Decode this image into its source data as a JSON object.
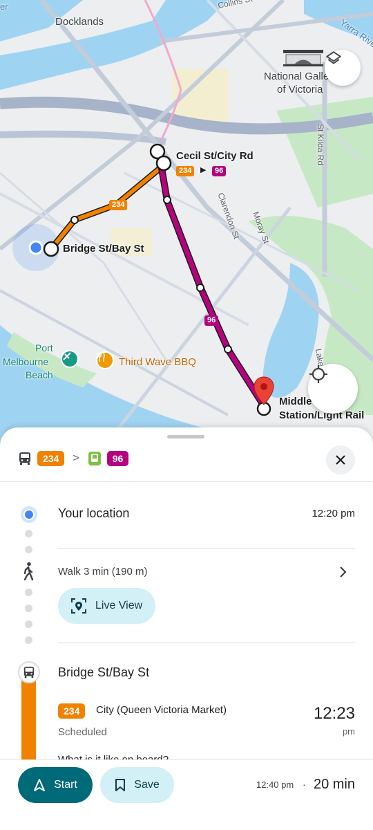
{
  "map": {
    "labels": {
      "docklands": "Docklands",
      "collins": "Collins St",
      "yarra": "Yarra River",
      "ngv_line1": "National Galle",
      "ngv_line2": "of Victoria",
      "stkilda": "St Kilda Rd",
      "clarendon": "Clarendon St",
      "moray": "Moray St",
      "lake": "Lake",
      "port_line1": "Port",
      "port_line2": "Melbourne",
      "port_line3": "Beach",
      "bbq": "Third Wave BBQ",
      "er": "er"
    },
    "stops": {
      "cecil": "Cecil St/City Rd",
      "bridge": "Bridge St/Bay St",
      "middle_line1": "Middle",
      "middle_line2": "Station/Light Rail"
    },
    "badges": {
      "route_a": "234",
      "route_b": "96",
      "route_a_line": "234",
      "route_b_line": "96"
    },
    "icons": [
      "layers-icon",
      "my-location-icon",
      "destination-pin-icon",
      "ngv-landmark-icon"
    ]
  },
  "sheet": {
    "summary": {
      "route_a": "234",
      "route_b": "96",
      "separator": ">"
    },
    "origin": {
      "title": "Your location",
      "time": "12:20 pm"
    },
    "walk": {
      "text": "Walk 3 min (190 m)",
      "live_view": "Live View"
    },
    "stop": {
      "title": "Bridge St/Bay St",
      "route": "234",
      "direction": "City (Queen Victoria Market)",
      "status": "Scheduled",
      "departure_time": "12:23",
      "departure_period": "pm",
      "partial_text": "What is it like on board?"
    }
  },
  "bottom_bar": {
    "start_label": "Start",
    "save_label": "Save",
    "arrival_time": "12:40 pm",
    "separator": "·",
    "duration": "20 min"
  },
  "colors": {
    "route_orange": "#f08200",
    "route_magenta": "#b5037f",
    "accent_teal": "#006a79",
    "light_teal": "#d3f0f7",
    "location_blue": "#4285f4"
  }
}
